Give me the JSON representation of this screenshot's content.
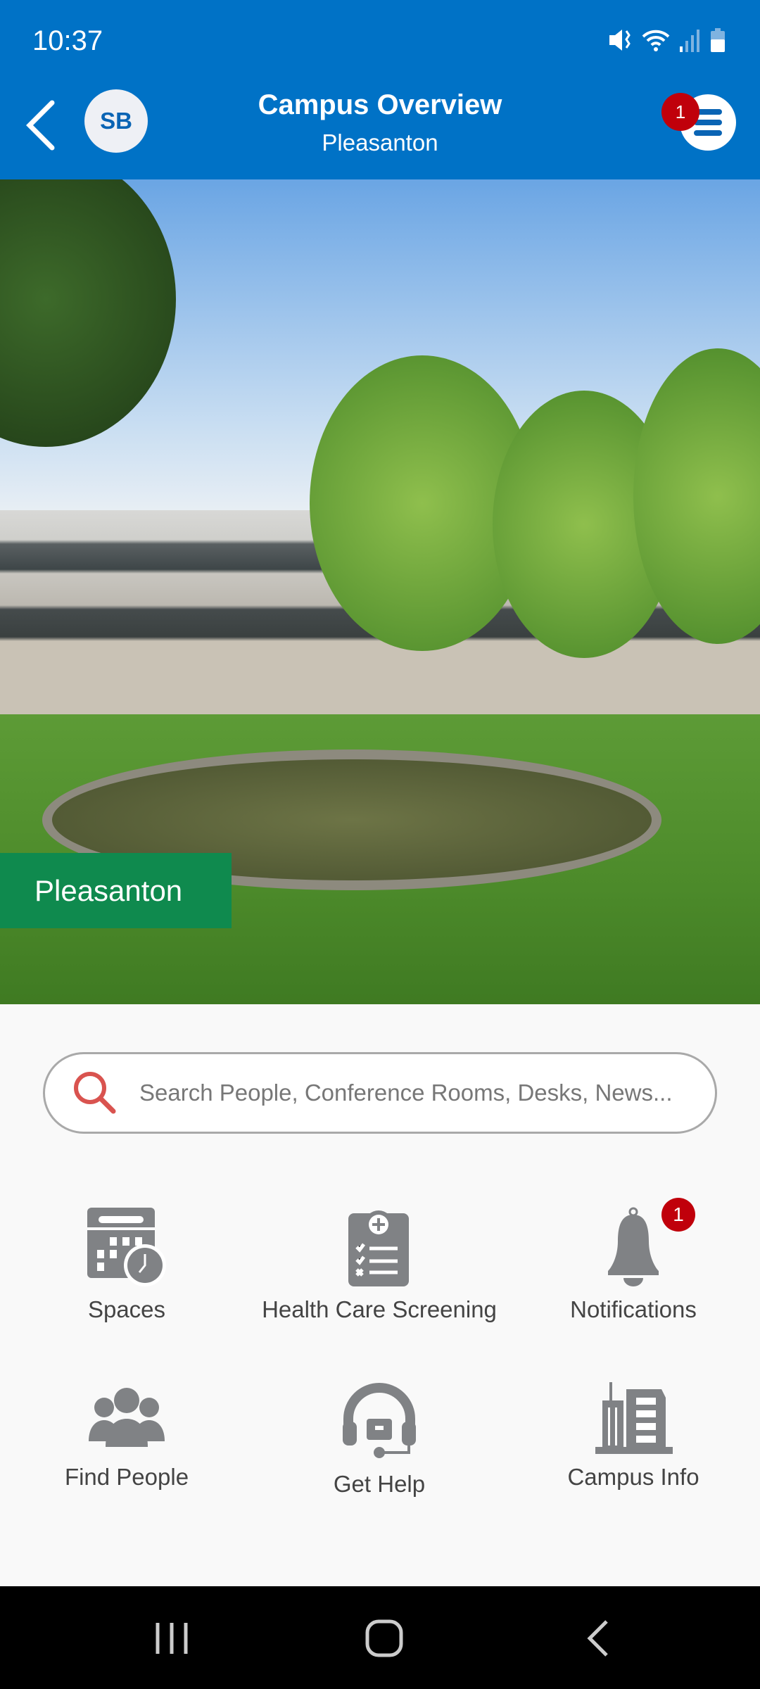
{
  "status": {
    "time": "10:37"
  },
  "header": {
    "title": "Campus Overview",
    "subtitle": "Pleasanton",
    "avatar_initials": "SB",
    "menu_badge": "1"
  },
  "hero": {
    "location_label": "Pleasanton"
  },
  "search": {
    "placeholder": "Search People, Conference Rooms, Desks, News..."
  },
  "tiles": [
    {
      "label": "Spaces",
      "icon": "calendar-clock-icon"
    },
    {
      "label": "Health Care Screening",
      "icon": "clipboard-checklist-icon"
    },
    {
      "label": "Notifications",
      "icon": "bell-icon",
      "badge": "1"
    },
    {
      "label": "Find People",
      "icon": "people-group-icon"
    },
    {
      "label": "Get Help",
      "icon": "headset-icon"
    },
    {
      "label": "Campus Info",
      "icon": "building-icon"
    }
  ],
  "colors": {
    "primary": "#0072c6",
    "badge": "#c0000b",
    "location": "#0f8a4e",
    "icon": "#808285"
  }
}
